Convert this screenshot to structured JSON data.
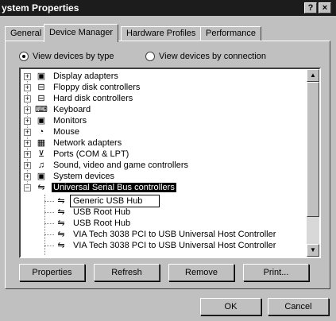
{
  "window": {
    "title": "ystem Properties",
    "help_label": "?",
    "close_label": "×"
  },
  "tabs": [
    {
      "label": "General",
      "active": false
    },
    {
      "label": "Device Manager",
      "active": true
    },
    {
      "label": "Hardware Profiles",
      "active": false
    },
    {
      "label": "Performance",
      "active": false
    }
  ],
  "view_options": {
    "by_type": {
      "label": "View devices by type",
      "checked": true
    },
    "by_connection": {
      "label": "View devices by connection",
      "checked": false
    }
  },
  "tree": {
    "categories": [
      {
        "label": "Display adapters",
        "icon": "monitor-icon",
        "expander": "+"
      },
      {
        "label": "Floppy disk controllers",
        "icon": "drive-icon",
        "expander": "+"
      },
      {
        "label": "Hard disk controllers",
        "icon": "drive-icon",
        "expander": "+"
      },
      {
        "label": "Keyboard",
        "icon": "keyboard-icon",
        "expander": "+"
      },
      {
        "label": "Monitors",
        "icon": "monitor-icon",
        "expander": "+"
      },
      {
        "label": "Mouse",
        "icon": "mouse-icon",
        "expander": "+"
      },
      {
        "label": "Network adapters",
        "icon": "network-icon",
        "expander": "+"
      },
      {
        "label": "Ports (COM & LPT)",
        "icon": "port-icon",
        "expander": "+"
      },
      {
        "label": "Sound, video and game controllers",
        "icon": "sound-icon",
        "expander": "+"
      },
      {
        "label": "System devices",
        "icon": "computer-icon",
        "expander": "+"
      },
      {
        "label": "Universal Serial Bus controllers",
        "icon": "usb-icon",
        "expander": "−"
      }
    ],
    "usb_children": [
      {
        "label": "Generic USB Hub",
        "icon": "usb-icon"
      },
      {
        "label": "USB Root Hub",
        "icon": "usb-icon"
      },
      {
        "label": "USB Root Hub",
        "icon": "usb-icon"
      },
      {
        "label": "VIA Tech 3038 PCI to USB Universal Host Controller",
        "icon": "usb-icon"
      },
      {
        "label": "VIA Tech 3038 PCI to USB Universal Host Controller",
        "icon": "usb-icon"
      }
    ]
  },
  "buttons": {
    "properties": "Properties",
    "refresh": "Refresh",
    "remove": "Remove",
    "print": "Print...",
    "ok": "OK",
    "cancel": "Cancel"
  },
  "colors": {
    "face": "#c0c0c0",
    "title_bar": "#1c1c1c",
    "selection": "#000000"
  }
}
